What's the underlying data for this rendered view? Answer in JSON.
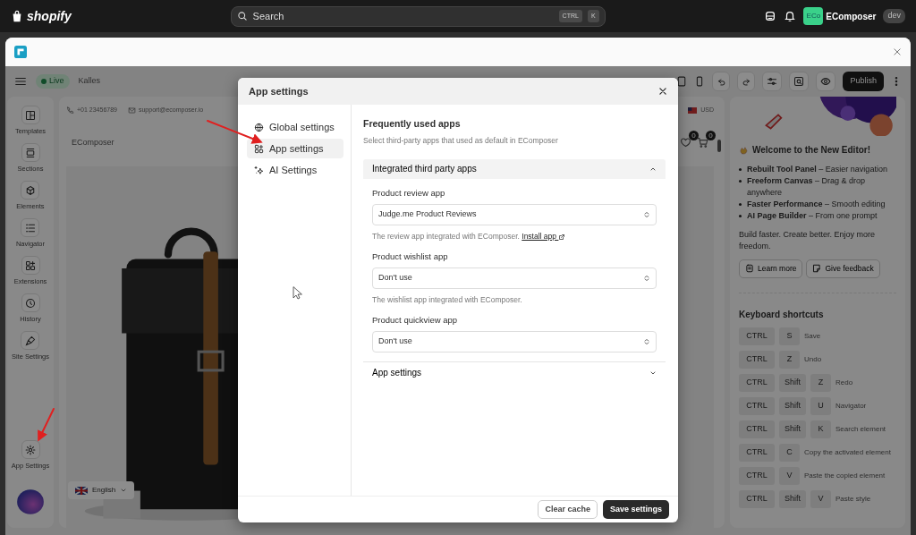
{
  "topbar": {
    "logo": "shopify",
    "search": {
      "placeholder": "Search",
      "keys": [
        "CTRL",
        "K"
      ]
    },
    "account": {
      "initials": "ECo",
      "name": "EComposer",
      "badge": "dev"
    }
  },
  "toolbar": {
    "status": "Live",
    "store": "Kalles",
    "publish": "Publish"
  },
  "sidebar": {
    "items": [
      {
        "label": "Templates",
        "kind": "layout"
      },
      {
        "label": "Sections",
        "kind": "sections"
      },
      {
        "label": "Elements",
        "kind": "cube"
      },
      {
        "label": "Navigator",
        "kind": "list"
      },
      {
        "label": "Extensions",
        "kind": "grid"
      },
      {
        "label": "History",
        "kind": "clock"
      },
      {
        "label": "Site Settings",
        "kind": "brush"
      }
    ],
    "footer": {
      "label": "App Settings",
      "kind": "gear"
    }
  },
  "canvas": {
    "phone": "+01 23456789",
    "email": "support@ecomposer.io",
    "currency": "USD",
    "brand": "EComposer",
    "wishlist_count": "0",
    "cart_count": "0",
    "language": "English"
  },
  "right_panel": {
    "title": "Welcome to the New Editor!",
    "features": [
      "**Rebuilt Tool Panel** – Easier navigation",
      "**Freeform Canvas** – Drag & drop anywhere",
      "**Faster Performance** – Smooth editing",
      "**AI Page Builder** – From one prompt"
    ],
    "tagline": "Build faster. Create better. Enjoy more freedom.",
    "buttons": [
      {
        "label": "Learn more",
        "kind": "doc"
      },
      {
        "label": "Give feedback",
        "kind": "note"
      }
    ],
    "shortcuts_title": "Keyboard shortcuts",
    "shortcuts": [
      {
        "keys": [
          "CTRL",
          "S"
        ],
        "action": "Save"
      },
      {
        "keys": [
          "CTRL",
          "Z"
        ],
        "action": "Undo"
      },
      {
        "keys": [
          "CTRL",
          "Shift",
          "Z"
        ],
        "action": "Redo"
      },
      {
        "keys": [
          "CTRL",
          "Shift",
          "U"
        ],
        "action": "Navigator"
      },
      {
        "keys": [
          "CTRL",
          "Shift",
          "K"
        ],
        "action": "Search element"
      },
      {
        "keys": [
          "CTRL",
          "C"
        ],
        "action": "Copy the activated element"
      },
      {
        "keys": [
          "CTRL",
          "V"
        ],
        "action": "Paste the copied element"
      },
      {
        "keys": [
          "CTRL",
          "Shift",
          "V"
        ],
        "action": "Paste style"
      }
    ]
  },
  "modal": {
    "title": "App settings",
    "nav": [
      {
        "label": "Global settings",
        "kind": "globe",
        "selected": false
      },
      {
        "label": "App settings",
        "kind": "apps",
        "selected": true
      },
      {
        "label": "AI Settings",
        "kind": "sparkle",
        "selected": false
      }
    ],
    "heading": "Frequently used apps",
    "subheading": "Select third-party apps that used as default in EComposer",
    "sections": [
      {
        "title": "Integrated third party apps",
        "expanded": true,
        "fields": [
          {
            "label": "Product review app",
            "value": "Judge.me Product Reviews",
            "help": "The review app integrated with EComposer.",
            "link": "Install app"
          },
          {
            "label": "Product wishlist app",
            "value": "Don't use",
            "help": "The wishlist app integrated with EComposer."
          },
          {
            "label": "Product quickview app",
            "value": "Don't use"
          }
        ]
      },
      {
        "title": "App settings",
        "expanded": false
      }
    ],
    "buttons": [
      {
        "label": "Clear cache",
        "kind": "secondary"
      },
      {
        "label": "Save settings",
        "kind": "primary"
      }
    ]
  }
}
